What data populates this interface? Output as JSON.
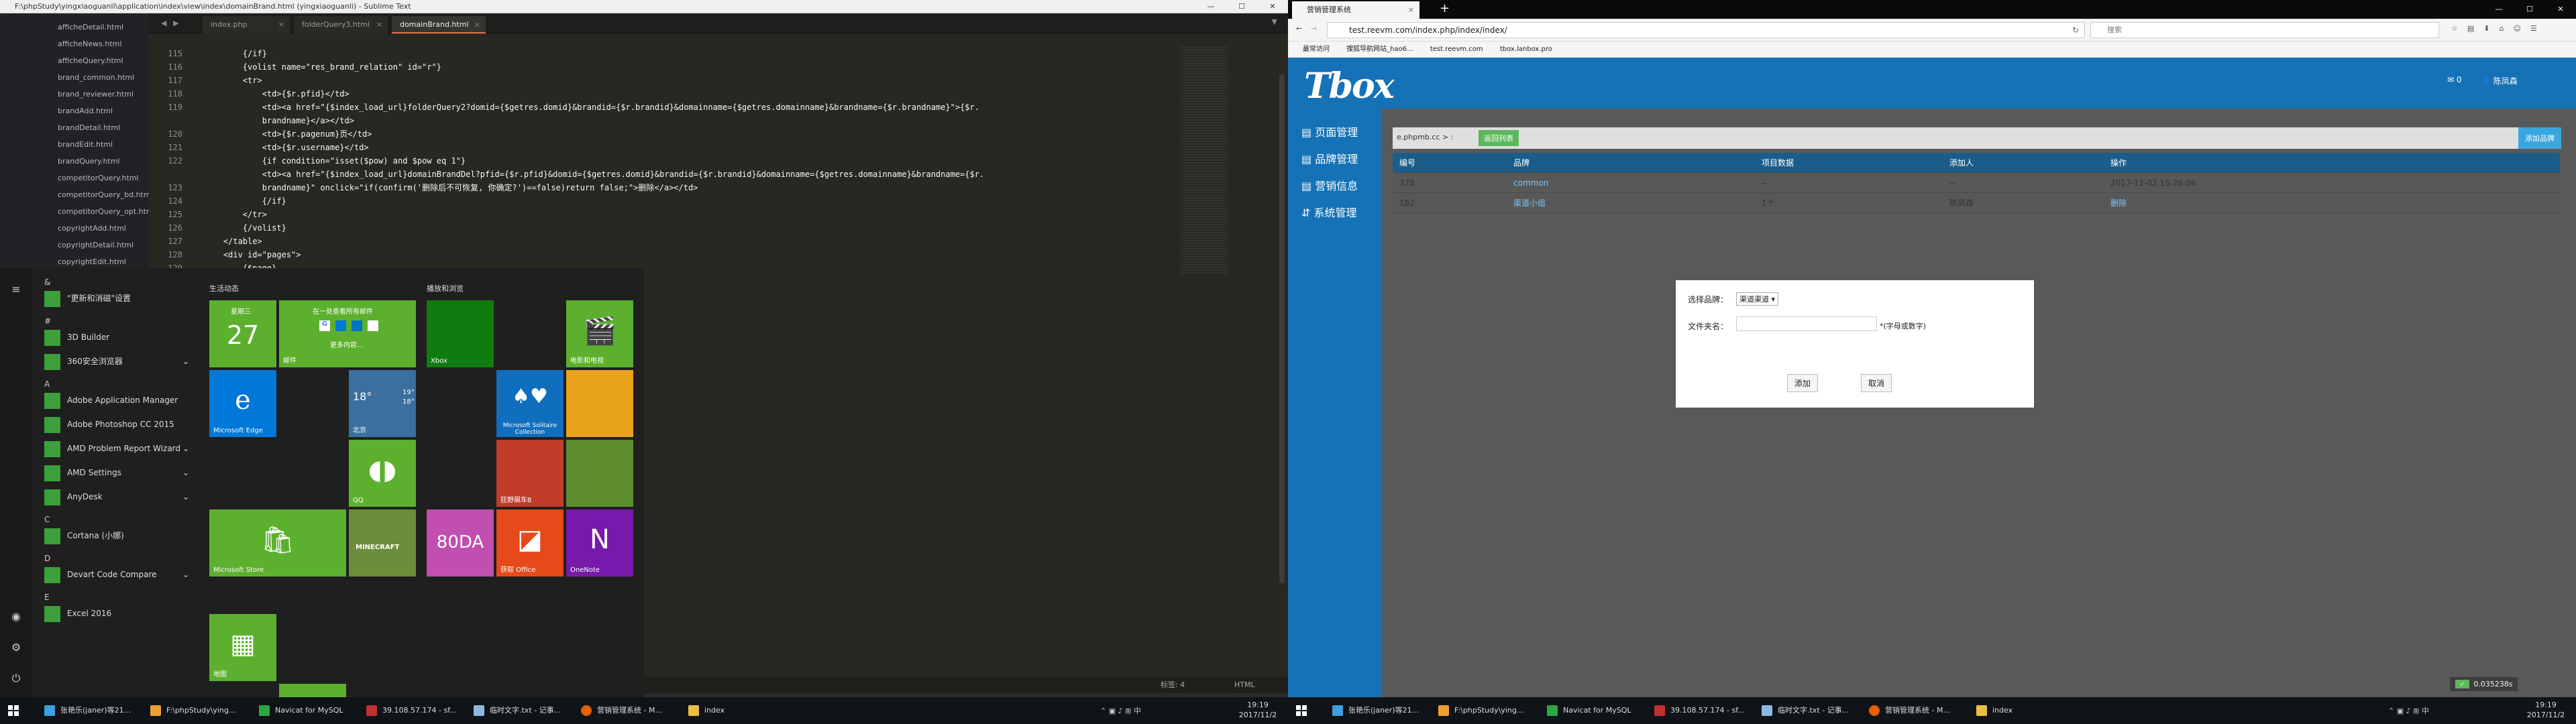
{
  "left": {
    "title": "F:\\phpStudy\\yingxiaoguanli\\application\\index\\view\\index\\domainBrand.html (yingxiaoguanli) - Sublime Text",
    "sidebar": [
      "afficheDetail.html",
      "afficheNews.html",
      "afficheQuery.html",
      "brand_common.html",
      "brand_reviewer.html",
      "brandAdd.html",
      "brandDetail.html",
      "brandEdit.html",
      "brandQuery.html",
      "competitorQuery.html",
      "competitorQuery_bd.html",
      "competitorQuery_opt.html",
      "copyrightAdd.html",
      "copyrightDetail.html",
      "copyrightEdit.html"
    ],
    "tabs": [
      "index.php",
      "folderQuery3.html",
      "domainBrand.html"
    ],
    "lines": [
      "115",
      "116",
      "117",
      "118",
      "119",
      "",
      "120",
      "121",
      "122",
      "",
      "123",
      "124",
      "125",
      "126",
      "127",
      "128",
      "129"
    ],
    "code": [
      "        {/if}",
      "        {volist name=\"res_brand_relation\" id=\"r\"}",
      "        <tr>",
      "            <td>{$r.pfid}</td>",
      "            <td><a href=\"{$index_load_url}folderQuery2?domid={$getres.domid}&brandid={$r.brandid}&domainname={$getres.domainname}&brandname={$r.brandname}\">{$r.",
      "            brandname}</a></td>",
      "            <td>{$r.pagenum}页</td>",
      "            <td>{$r.username}</td>",
      "            {if condition=\"isset($pow) and $pow eq 1\"}",
      "            <td><a href=\"{$index_load_url}domainBrandDel?pfid={$r.pfid}&domid={$getres.domid}&brandid={$r.brandid}&domainname={$getres.domainname}&brandname={$r.",
      "            brandname}\" onclick=\"if(confirm('删除后不可恢复, 你确定?')==false)return false;\">删除</a></td>",
      "            {/if}",
      "        </tr>",
      "        {/volist}",
      "    </table>",
      "    <div id=\"pages\">",
      "        {$page}"
    ],
    "status": {
      "tab": "标签: 4",
      "syntax": "HTML"
    },
    "start": {
      "rail": [
        "≡",
        "◉",
        "⚙",
        "⏻"
      ],
      "items": [
        [
          "&",
          ""
        ],
        [
          "\"更新和消磁\"设置",
          ""
        ],
        [
          "#",
          ""
        ],
        [
          "3D Builder",
          ""
        ],
        [
          "360安全浏览器",
          "⌄"
        ],
        [
          "A",
          ""
        ],
        [
          "Adobe Application Manager",
          ""
        ],
        [
          "Adobe Photoshop CC 2015",
          ""
        ],
        [
          "AMD Problem Report Wizard",
          "⌄"
        ],
        [
          "AMD Settings",
          "⌄"
        ],
        [
          "AnyDesk",
          "⌄"
        ],
        [
          "C",
          ""
        ],
        [
          "Cortana (小娜)",
          ""
        ],
        [
          "D",
          ""
        ],
        [
          "Devart Code Compare",
          "⌄"
        ],
        [
          "E",
          ""
        ],
        [
          "Excel 2016",
          ""
        ]
      ],
      "groups": [
        "生活动态",
        "播放和浏览"
      ],
      "tiles": {
        "cal_day": "星期三",
        "cal_num": "27",
        "mail": "邮件",
        "mail_top": "在一处查看所有邮件",
        "mail_more": "更多内容...",
        "xbox": "Xbox",
        "films": "电影和电视",
        "edge": "Microsoft Edge",
        "weather_temp": "18°",
        "weather_hi": "19°",
        "weather_lo": "18°",
        "weather_city": "北京",
        "solitaire": "Microsoft Solitaire Collection",
        "qq": "QQ",
        "racing": "狂野飙车8",
        "store": "Microsoft Store",
        "minecraft": "MINECRAFT",
        "candy": "80DA",
        "office": "获取 Office",
        "onenote": "OneNote",
        "maps": "地图"
      }
    }
  },
  "right": {
    "tab": "营销管理系统",
    "url": "test.reevm.com/index.php/index/index/",
    "search": "搜索",
    "bookmarks": [
      "最常访问",
      "搜狐导航网站_hao6...",
      "test.reevm.com",
      "tbox.lanbox.pro"
    ],
    "logo": "Tbox",
    "header_user": "陈凤森",
    "header_badge": "0",
    "nav": [
      "页面管理",
      "品牌管理",
      "营销信息",
      "系统管理"
    ],
    "crumb": "e.phpmb.cc > :",
    "back": "返回列表",
    "add_brand": "添加品牌",
    "table": {
      "headers": [
        "编号",
        "品牌",
        "项目数据",
        "添加人",
        "操作"
      ],
      "rows": [
        [
          "378",
          "common",
          "--",
          "--",
          "2017-11-02 15:26:06"
        ],
        [
          "182",
          "渠道小组",
          "1个",
          "陈凤森",
          "删除"
        ]
      ]
    },
    "modal": {
      "brand_label": "选择品牌：",
      "brand_value": "渠道渠道",
      "name_label": "文件夹名：",
      "hint": "*(字母或数字)",
      "ok": "添加",
      "cancel": "取消"
    },
    "speed": "0.035238s"
  },
  "taskbar": {
    "items": [
      "张艳乐(janer)等21...",
      "F:\\phpStudy\\ying...",
      "Navicat for MySQL",
      "39.108.57.174 - sf...",
      "临时文字.txt - 记事...",
      "营销管理系统 - M...",
      "index"
    ],
    "time": "19:19",
    "date": "2017/11/2"
  }
}
